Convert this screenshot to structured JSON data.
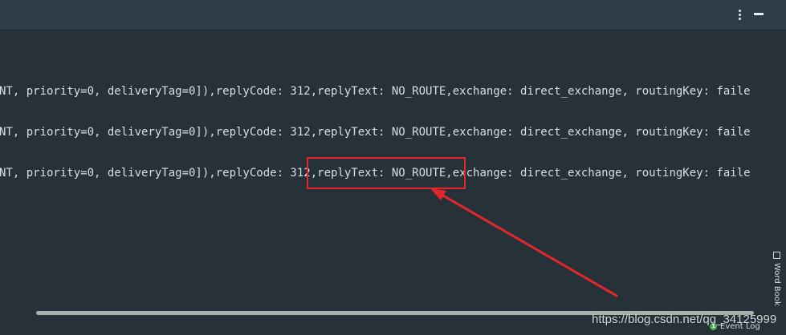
{
  "console": {
    "lines": [
      "NT, priority=0, deliveryTag=0]),replyCode: 312,replyText: NO_ROUTE,exchange: direct_exchange, routingKey: faile",
      "NT, priority=0, deliveryTag=0]),replyCode: 312,replyText: NO_ROUTE,exchange: direct_exchange, routingKey: faile",
      "NT, priority=0, deliveryTag=0]),replyCode: 312,replyText: NO_ROUTE,exchange: direct_exchange, routingKey: faile"
    ]
  },
  "topbar": {
    "more_icon": "more-vertical-icon",
    "minimize_icon": "minimize-icon"
  },
  "sidebar": {
    "word_book_label": "Word Book",
    "word_book_icon": "book-icon"
  },
  "status": {
    "event_log_label": "Event Log",
    "event_log_icon": "event-log-icon"
  },
  "annotation": {
    "highlight_color": "#e2262b",
    "arrow_color": "#e2262b"
  },
  "watermark": {
    "text": "https://blog.csdn.net/qq_34125999"
  },
  "colors": {
    "background": "#263238",
    "toolbar": "#2f3e46",
    "text": "#d6dfe3"
  }
}
